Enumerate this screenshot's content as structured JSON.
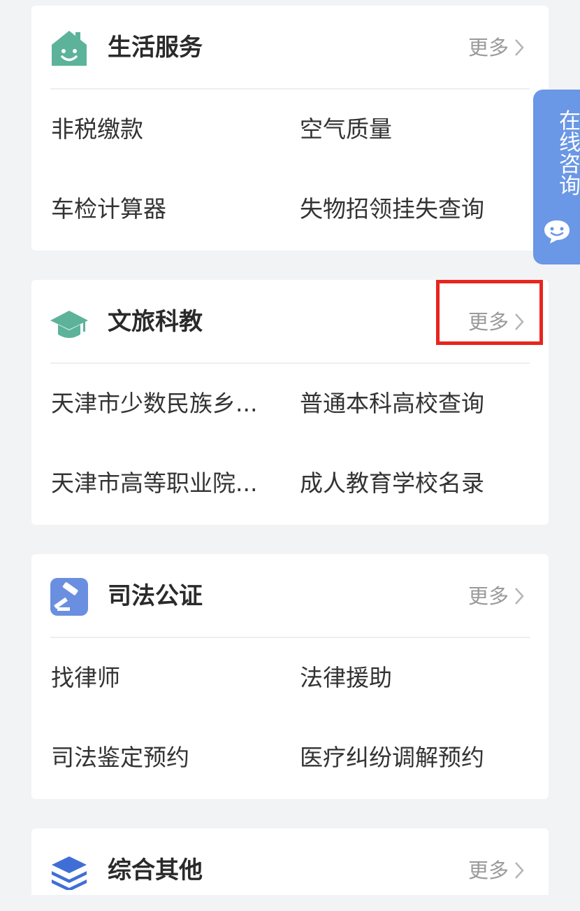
{
  "float_tab": {
    "label": "在线咨询",
    "icon": "chat-bubble-icon",
    "color": "#6a97e6"
  },
  "highlight_color": "#e8251e",
  "sections": [
    {
      "title": "生活服务",
      "icon": "house-smile-icon",
      "more": "更多",
      "items": [
        "非税缴款",
        "空气质量",
        "车检计算器",
        "失物招领挂失查询"
      ]
    },
    {
      "title": "文旅科教",
      "icon": "graduation-cap-icon",
      "more": "更多",
      "items": [
        "天津市少数民族乡...",
        "普通本科高校查询",
        "天津市高等职业院...",
        "成人教育学校名录"
      ]
    },
    {
      "title": "司法公证",
      "icon": "gavel-icon",
      "more": "更多",
      "items": [
        "找律师",
        "法律援助",
        "司法鉴定预约",
        "医疗纠纷调解预约"
      ]
    },
    {
      "title": "综合其他",
      "icon": "layers-icon",
      "more": "更多",
      "items": []
    }
  ]
}
